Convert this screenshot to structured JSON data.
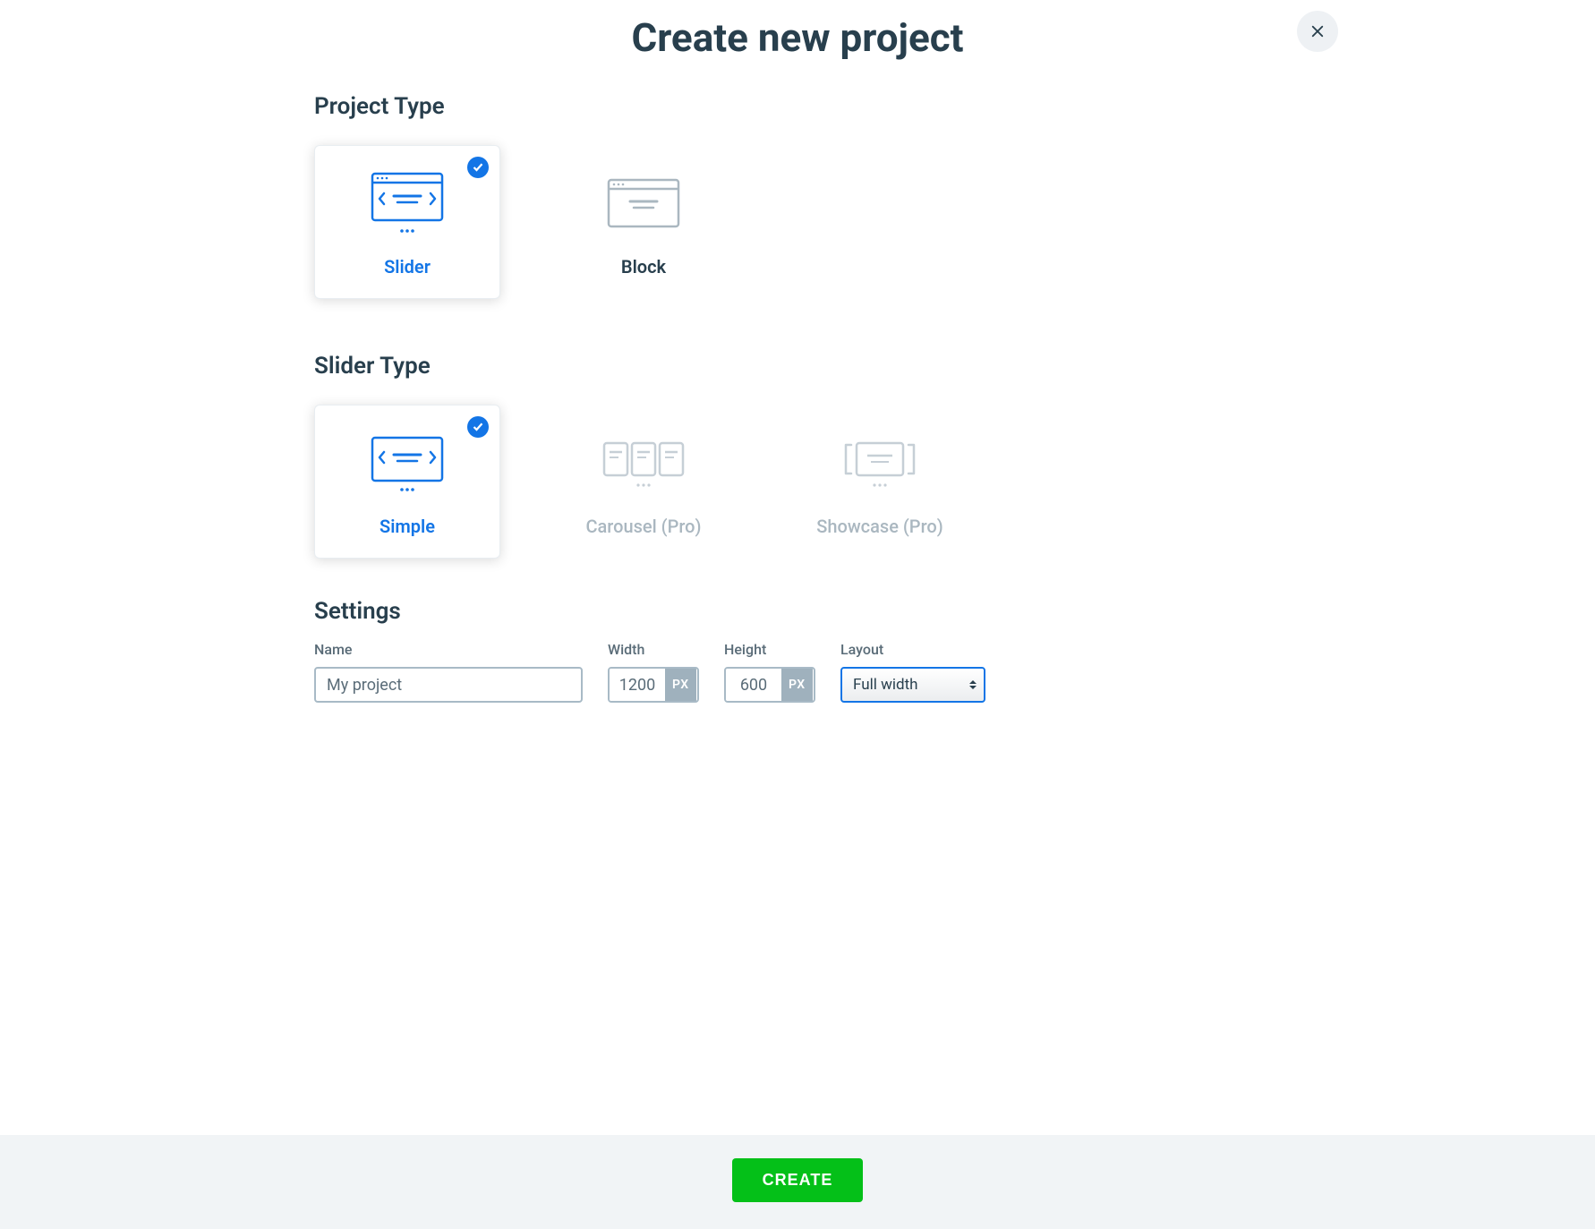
{
  "header": {
    "title": "Create new project"
  },
  "sections": {
    "project_type_title": "Project Type",
    "slider_type_title": "Slider Type",
    "settings_title": "Settings"
  },
  "project_types": {
    "slider": "Slider",
    "block": "Block"
  },
  "slider_types": {
    "simple": "Simple",
    "carousel": "Carousel (Pro)",
    "showcase": "Showcase (Pro)"
  },
  "settings": {
    "name_label": "Name",
    "name_value": "My project",
    "width_label": "Width",
    "width_value": "1200",
    "width_unit": "PX",
    "height_label": "Height",
    "height_value": "600",
    "height_unit": "PX",
    "layout_label": "Layout",
    "layout_value": "Full width"
  },
  "footer": {
    "create_label": "CREATE"
  },
  "colors": {
    "accent": "#1375e6",
    "success": "#04c018",
    "muted": "#aab7c0"
  }
}
